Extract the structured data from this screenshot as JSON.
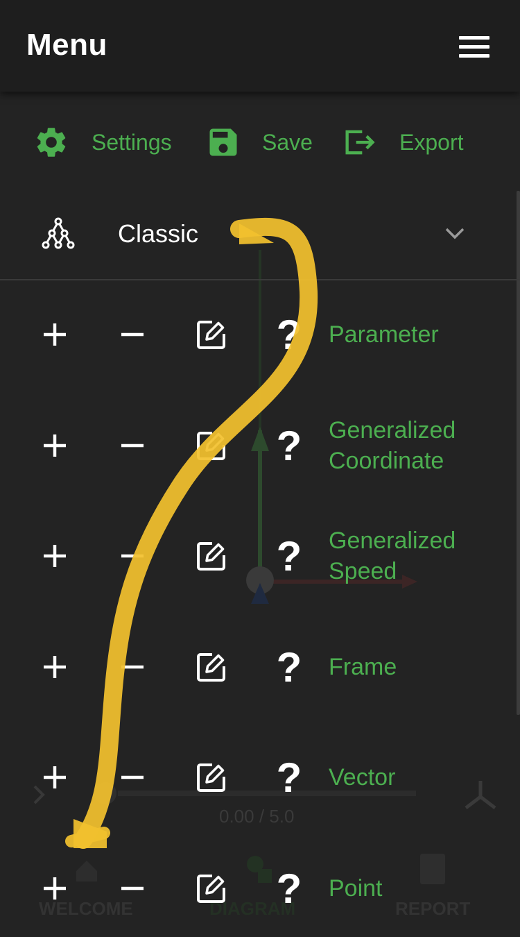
{
  "header": {
    "title": "Menu",
    "menu_icon": "hamburger-menu-icon"
  },
  "toolbar": {
    "settings_label": "Settings",
    "save_label": "Save",
    "export_label": "Export",
    "icons": [
      "gear-icon",
      "save-icon",
      "export-icon"
    ]
  },
  "selector": {
    "value": "Classic",
    "icon": "tree-network-icon",
    "expand_icon": "chevron-down-icon"
  },
  "rows": [
    {
      "label": "Parameter"
    },
    {
      "label": "Generalized Coordinate"
    },
    {
      "label": "Generalized Speed"
    },
    {
      "label": "Frame"
    },
    {
      "label": "Vector"
    },
    {
      "label": "Point"
    }
  ],
  "row_controls": {
    "add": "+",
    "remove": "−",
    "help": "?"
  },
  "background": {
    "timeline_text": "0.00 / 5.0",
    "nav": {
      "welcome": "WELCOME",
      "diagram": "DIAGRAM",
      "report": "REPORT"
    }
  },
  "colors": {
    "accent": "#4caf50",
    "background": "#232323",
    "header": "#1e1e1e",
    "annotation": "#f2c12e"
  }
}
